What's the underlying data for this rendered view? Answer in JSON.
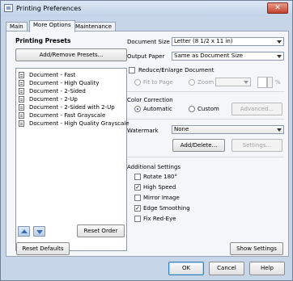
{
  "window": {
    "title": "Printing Preferences",
    "close_glyph": "✕"
  },
  "tabs": [
    {
      "label": "Main",
      "active": false
    },
    {
      "label": "More Options",
      "active": true
    },
    {
      "label": "Maintenance",
      "active": false
    }
  ],
  "presets": {
    "heading": "Printing Presets",
    "add_remove_button": "Add/Remove Presets...",
    "items": [
      "Document - Fast",
      "Document - High Quality",
      "Document - 2-Sided",
      "Document - 2-Up",
      "Document - 2-Sided with 2-Up",
      "Document - Fast Grayscale",
      "Document - High Quality Grayscale"
    ],
    "reset_order_button": "Reset Order"
  },
  "document_size": {
    "label": "Document Size",
    "value": "Letter (8 1/2 x 11 in)"
  },
  "output_paper": {
    "label": "Output Paper",
    "value": "Same as Document Size"
  },
  "reduce_enlarge": {
    "label": "Reduce/Enlarge Document",
    "checked": false,
    "fit_to_page": "Fit to Page",
    "zoom_to": "Zoom to",
    "percent_sign": "%"
  },
  "color_correction": {
    "label": "Color Correction",
    "automatic": "Automatic",
    "custom": "Custom",
    "advanced_button": "Advanced...",
    "selected": "Automatic"
  },
  "watermark": {
    "label": "Watermark",
    "value": "None",
    "add_delete_button": "Add/Delete...",
    "settings_button": "Settings..."
  },
  "additional_settings": {
    "label": "Additional Settings",
    "options": [
      {
        "label": "Rotate 180°",
        "checked": false
      },
      {
        "label": "High Speed",
        "checked": true
      },
      {
        "label": "Mirror Image",
        "checked": false
      },
      {
        "label": "Edge Smoothing",
        "checked": true
      },
      {
        "label": "Fix Red-Eye",
        "checked": false
      }
    ],
    "check_glyph": "✓"
  },
  "footer": {
    "reset_defaults": "Reset Defaults",
    "show_settings": "Show Settings",
    "ok": "OK",
    "cancel": "Cancel",
    "help": "Help"
  },
  "icons": {
    "app": "printer-preferences-icon",
    "close": "close-icon",
    "preset_item": "document-icon",
    "move_up": "arrow-up-icon",
    "move_down": "arrow-down-icon",
    "dropdown": "chevron-down-icon"
  },
  "colors": {
    "chrome": "#c6d5e8",
    "panel": "#f4f6f9",
    "close_button": "#c1422e",
    "arrow_buttons": "#3a6fb5"
  }
}
